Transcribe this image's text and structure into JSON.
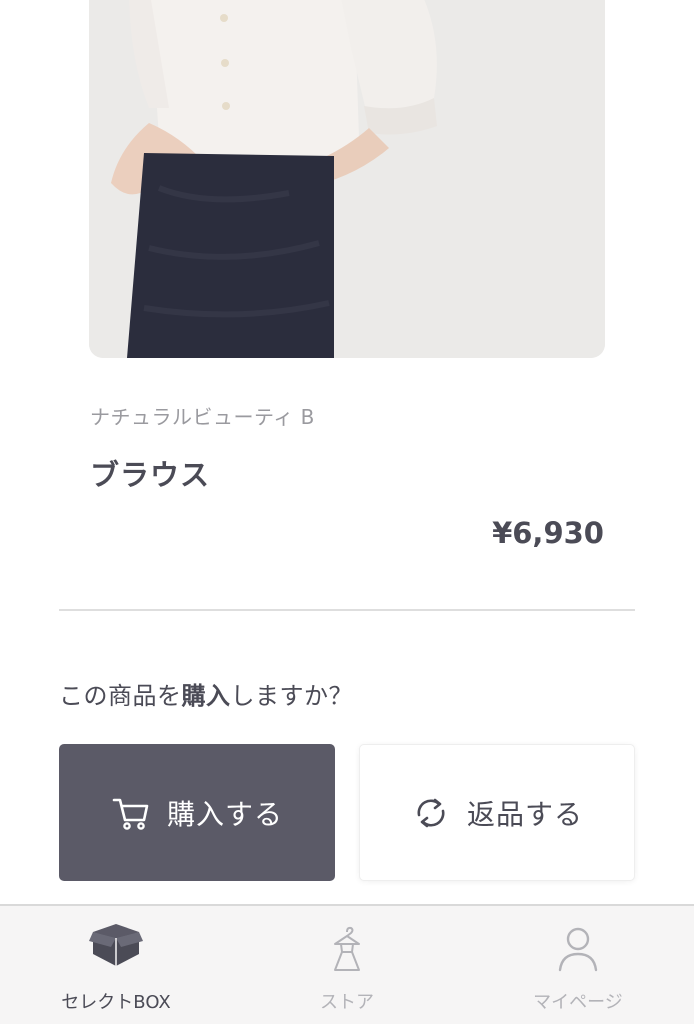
{
  "product": {
    "brand": "ナチュラルビューティ B",
    "name": "ブラウス",
    "price": "¥6,930"
  },
  "purchase": {
    "question_before": "この商品を",
    "question_bold": "購入",
    "question_after": "しますか？",
    "buy_label": "購入する",
    "buy_icon": "cart-icon",
    "return_label": "返品する",
    "return_icon": "refresh-icon"
  },
  "tabs": [
    {
      "label": "セレクトBOX",
      "icon": "box-icon",
      "active": true
    },
    {
      "label": "ストア",
      "icon": "dress-hanger-icon",
      "active": false
    },
    {
      "label": "マイページ",
      "icon": "person-icon",
      "active": false
    }
  ],
  "colors": {
    "primary_button": "#5b5a67",
    "text": "#4b4b56",
    "muted": "#9a9a9f",
    "tab_inactive": "#b3b3b8"
  }
}
